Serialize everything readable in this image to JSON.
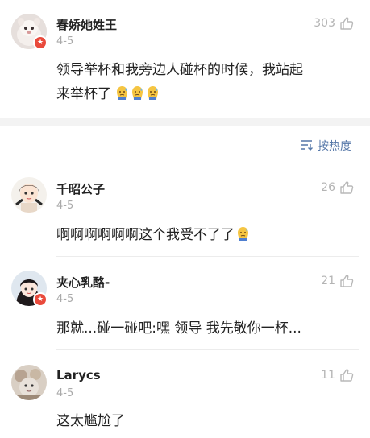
{
  "main_comment": {
    "user": "春娇她姓王",
    "date": "4-5",
    "likes": "303",
    "text": "领导举杯和我旁边人碰杯的时候，我站起",
    "text_line2": "来举杯了"
  },
  "sort": {
    "label": "按热度",
    "icon": "sort-lines-icon"
  },
  "replies": [
    {
      "user": "千昭公子",
      "date": "4-5",
      "likes": "26",
      "text": "啊啊啊啊啊啊这个我受不了了"
    },
    {
      "user": "夹心乳酪-",
      "date": "4-5",
      "likes": "21",
      "text": "那就...碰一碰吧:嘿 领导 我先敬你一杯..."
    },
    {
      "user": "Larycs",
      "date": "4-5",
      "likes": "11",
      "text": "这太尴尬了"
    }
  ],
  "colors": {
    "link": "#5577a8",
    "badge": "#e94a3c",
    "muted": "#aaaaaa"
  }
}
